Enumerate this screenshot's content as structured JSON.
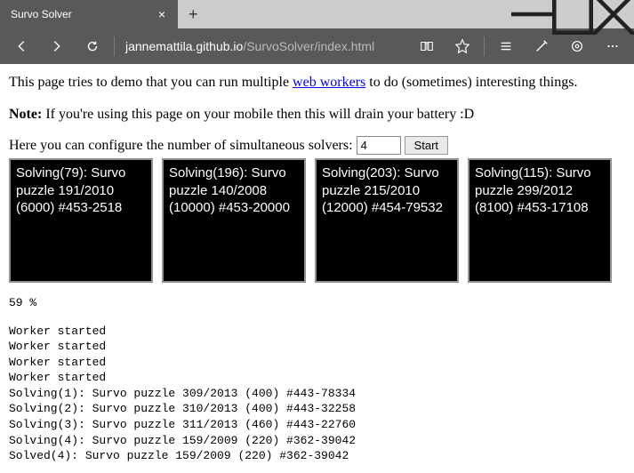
{
  "window": {
    "tab_title": "Survo Solver",
    "url_prefix": "jannemattila.github.io",
    "url_suffix": "/SurvoSolver/index.html"
  },
  "content": {
    "intro_1": "This page tries to demo that you can run multiple ",
    "intro_link": "web workers",
    "intro_2": " to do (sometimes) interesting things.",
    "note_label": "Note:",
    "note_text": " If you're using this page on your mobile then this will drain your battery :D",
    "config_label": "Here you can configure the number of simultaneous solvers: ",
    "config_value": "4",
    "start_label": "Start"
  },
  "solvers": [
    {
      "text": "Solving(79): Survo puzzle 191/2010 (6000) #453-2518"
    },
    {
      "text": "Solving(196): Survo puzzle 140/2008 (10000) #453-20000"
    },
    {
      "text": "Solving(203): Survo puzzle 215/2010 (12000) #454-79532"
    },
    {
      "text": "Solving(115): Survo puzzle 299/2012 (8100) #453-17108"
    }
  ],
  "progress": "59 %",
  "log": "Worker started\nWorker started\nWorker started\nWorker started\nSolving(1): Survo puzzle 309/2013 (400) #443-78334\nSolving(2): Survo puzzle 310/2013 (400) #443-32258\nSolving(3): Survo puzzle 311/2013 (460) #443-22760\nSolving(4): Survo puzzle 159/2009 (220) #362-39042\nSolved(4): Survo puzzle 159/2009 (220) #362-39042"
}
